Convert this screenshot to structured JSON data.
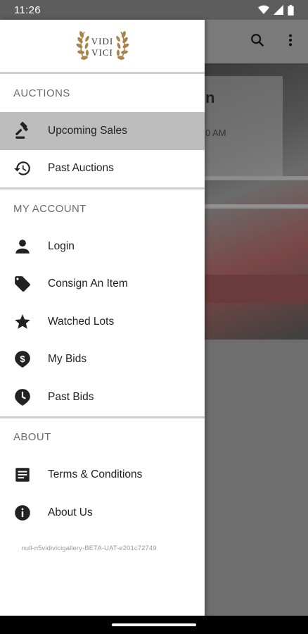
{
  "status_bar": {
    "time": "11:26"
  },
  "background_app": {
    "card_title": "n",
    "card_time": "0 AM"
  },
  "drawer": {
    "logo": {
      "line1": "VIDI",
      "line2": "VICI"
    },
    "sections": {
      "auctions": {
        "header": "AUCTIONS",
        "items": [
          {
            "label": "Upcoming Sales",
            "icon": "gavel-icon"
          },
          {
            "label": "Past Auctions",
            "icon": "history-icon"
          }
        ]
      },
      "account": {
        "header": "MY ACCOUNT",
        "items": [
          {
            "label": "Login",
            "icon": "person-icon"
          },
          {
            "label": "Consign An Item",
            "icon": "tag-icon"
          },
          {
            "label": "Watched Lots",
            "icon": "star-icon"
          },
          {
            "label": "My Bids",
            "icon": "dollar-pin-icon"
          },
          {
            "label": "Past Bids",
            "icon": "clock-pin-icon"
          }
        ]
      },
      "about": {
        "header": "ABOUT",
        "items": [
          {
            "label": "Terms & Conditions",
            "icon": "document-icon"
          },
          {
            "label": "About Us",
            "icon": "info-icon"
          }
        ]
      }
    },
    "version": "null-n5vidivicigallery-BETA-UAT-e201c72749"
  },
  "colors": {
    "drawer_bg": "#ffffff",
    "active_item_bg": "#bdbdbd",
    "scrim": "#6e6e6e"
  }
}
